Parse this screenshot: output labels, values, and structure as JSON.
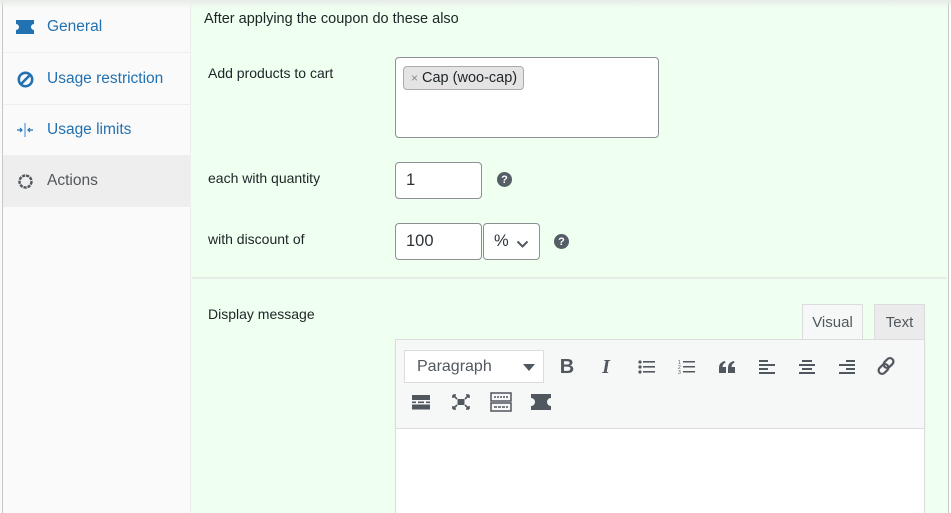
{
  "sidebar": {
    "items": [
      {
        "label": "General",
        "icon": "ticket-icon",
        "active": false
      },
      {
        "label": "Usage restriction",
        "icon": "block-icon",
        "active": false
      },
      {
        "label": "Usage limits",
        "icon": "limits-icon",
        "active": false
      },
      {
        "label": "Actions",
        "icon": "gear-icon",
        "active": true
      }
    ]
  },
  "main": {
    "heading": "After applying the coupon do these also",
    "add_products": {
      "label": "Add products to cart",
      "selected": [
        {
          "label": "Cap (woo-cap)",
          "remove_glyph": "×"
        }
      ]
    },
    "quantity": {
      "label": "each with quantity",
      "value": "1",
      "help": "?"
    },
    "discount": {
      "label": "with discount of",
      "value": "100",
      "type_value": "%",
      "help": "?"
    },
    "display_message": {
      "label": "Display message",
      "tabs": [
        "Visual",
        "Text"
      ],
      "active_tab": "Visual",
      "format_select": "Paragraph",
      "toolbar_row1": [
        "bold",
        "italic",
        "bulleted-list",
        "numbered-list",
        "blockquote",
        "align-left",
        "align-center",
        "align-right",
        "link"
      ],
      "toolbar_row2": [
        "read-more",
        "fullscreen",
        "toolbar-toggle",
        "coupon"
      ],
      "bold_glyph": "B",
      "italic_glyph": "I"
    }
  },
  "colors": {
    "accent": "#2271b1",
    "panel_bg": "#effff0",
    "sidebar_bg": "#fafafa",
    "active_tab_bg": "#eeeeee",
    "icon_dark": "#50575e"
  }
}
